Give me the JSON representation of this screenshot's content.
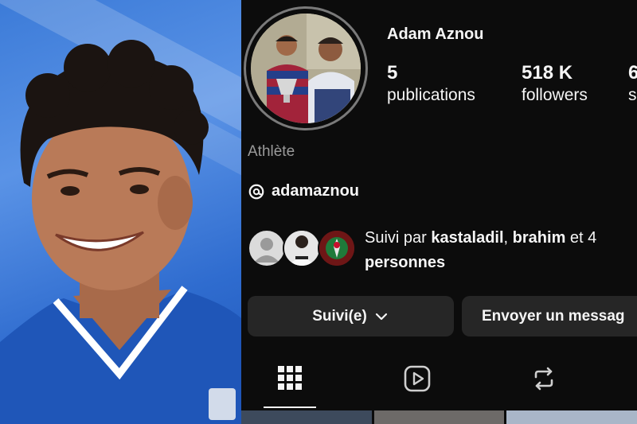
{
  "profile": {
    "username": "Adam Aznou",
    "stats": [
      {
        "value": "5",
        "label": "publications"
      },
      {
        "value": "518 K",
        "label": "followers"
      },
      {
        "value": "6",
        "label": "s"
      }
    ],
    "category": "Athlète",
    "threads_handle": "adamaznou",
    "followed_by": {
      "prefix": "Suivi par ",
      "name1": "kastaladil",
      "sep": ", ",
      "name2": "brahim",
      "suffix": " et 4",
      "line2": "personnes"
    },
    "buttons": {
      "follow": "Suivi(e)",
      "message": "Envoyer un messag"
    },
    "tabs": [
      "grid-icon",
      "reels-icon",
      "reposts-icon"
    ]
  },
  "colors": {
    "background": "#0c0c0c",
    "button": "#262626",
    "text": "#f5f5f5",
    "muted": "#9a9a9a",
    "jersey_blue": "#1f56b8"
  }
}
